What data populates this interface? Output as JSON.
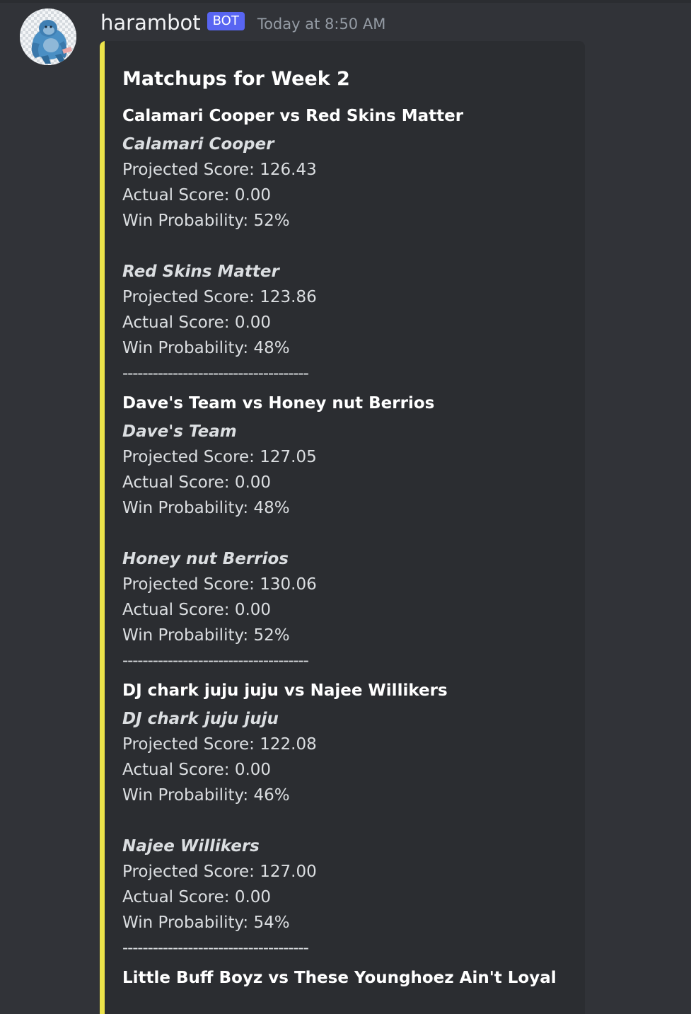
{
  "message": {
    "avatar_icon": "gorilla-avatar-icon",
    "username": "harambot",
    "badge": "BOT",
    "timestamp": "Today at 8:50 AM",
    "accent_color": "#ece34a",
    "badge_color": "#5865f2"
  },
  "embed": {
    "title": "Matchups for Week 2",
    "separator": "-------------------------------------",
    "matchups": [
      {
        "heading": "Calamari Cooper vs Red Skins Matter",
        "teams": [
          {
            "name": "Calamari Cooper",
            "projected": "Projected Score: 126.43",
            "actual": "Actual Score: 0.00",
            "win": "Win Probability: 52%"
          },
          {
            "name": "Red Skins Matter",
            "projected": "Projected Score: 123.86",
            "actual": "Actual Score: 0.00",
            "win": "Win Probability: 48%"
          }
        ]
      },
      {
        "heading": "Dave's Team vs Honey nut Berrios",
        "teams": [
          {
            "name": "Dave's Team",
            "projected": "Projected Score: 127.05",
            "actual": "Actual Score: 0.00",
            "win": "Win Probability: 48%"
          },
          {
            "name": "Honey nut Berrios",
            "projected": "Projected Score: 130.06",
            "actual": "Actual Score: 0.00",
            "win": "Win Probability: 52%"
          }
        ]
      },
      {
        "heading": "DJ chark juju juju vs Najee Willikers",
        "teams": [
          {
            "name": "DJ chark juju juju",
            "projected": "Projected Score: 122.08",
            "actual": "Actual Score: 0.00",
            "win": "Win Probability: 46%"
          },
          {
            "name": "Najee Willikers",
            "projected": "Projected Score: 127.00",
            "actual": "Actual Score: 0.00",
            "win": "Win Probability: 54%"
          }
        ]
      },
      {
        "heading": "Little Buff Boyz vs These Younghoez Ain't Loyal",
        "teams": []
      }
    ]
  }
}
